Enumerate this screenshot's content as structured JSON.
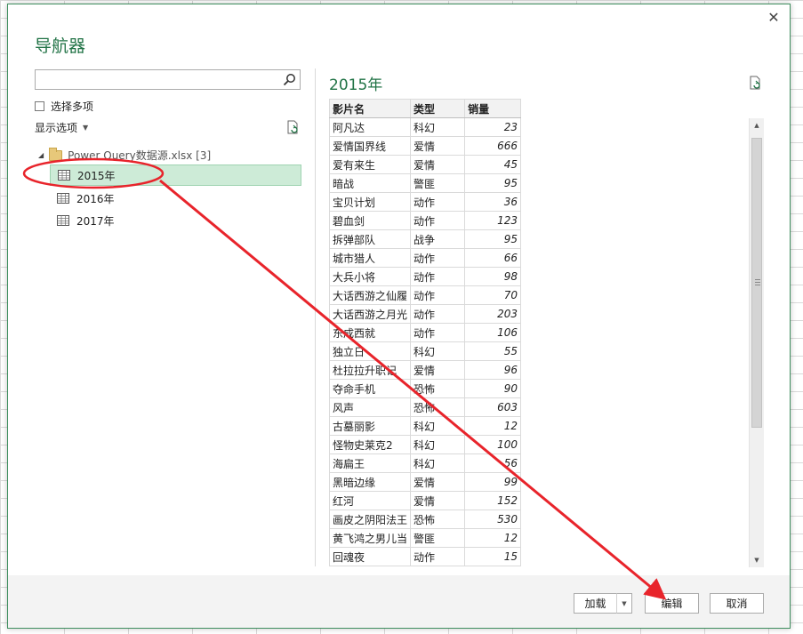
{
  "navigator": {
    "title": "导航器",
    "close_glyph": "✕",
    "search": {
      "value": "",
      "placeholder": ""
    },
    "select_multiple_label": "选择多项",
    "display_options_label": "显示选项",
    "tree": {
      "root_label": "Power Query数据源.xlsx [3]",
      "items": [
        {
          "label": "2015年",
          "selected": true
        },
        {
          "label": "2016年",
          "selected": false
        },
        {
          "label": "2017年",
          "selected": false
        }
      ]
    },
    "preview": {
      "title": "2015年",
      "columns": [
        "影片名",
        "类型",
        "销量"
      ],
      "rows": [
        [
          "阿凡达",
          "科幻",
          "23"
        ],
        [
          "爱情国界线",
          "爱情",
          "666"
        ],
        [
          "爱有来生",
          "爱情",
          "45"
        ],
        [
          "暗战",
          "警匪",
          "95"
        ],
        [
          "宝贝计划",
          "动作",
          "36"
        ],
        [
          "碧血剑",
          "动作",
          "123"
        ],
        [
          "拆弹部队",
          "战争",
          "95"
        ],
        [
          "城市猎人",
          "动作",
          "66"
        ],
        [
          "大兵小将",
          "动作",
          "98"
        ],
        [
          "大话西游之仙履",
          "动作",
          "70"
        ],
        [
          "大话西游之月光",
          "动作",
          "203"
        ],
        [
          "东成西就",
          "动作",
          "106"
        ],
        [
          "独立日",
          "科幻",
          "55"
        ],
        [
          "杜拉拉升职记",
          "爱情",
          "96"
        ],
        [
          "夺命手机",
          "恐怖",
          "90"
        ],
        [
          "风声",
          "恐怖",
          "603"
        ],
        [
          "古墓丽影",
          "科幻",
          "12"
        ],
        [
          "怪物史莱克2",
          "科幻",
          "100"
        ],
        [
          "海扁王",
          "科幻",
          "56"
        ],
        [
          "黑暗边缘",
          "爱情",
          "99"
        ],
        [
          "红河",
          "爱情",
          "152"
        ],
        [
          "画皮之阴阳法王",
          "恐怖",
          "530"
        ],
        [
          "黄飞鸿之男儿当",
          "警匪",
          "12"
        ],
        [
          "回魂夜",
          "动作",
          "15"
        ]
      ]
    },
    "buttons": {
      "load": "加载",
      "edit": "编辑",
      "cancel": "取消"
    },
    "colors": {
      "accent": "#217346",
      "selection": "#cdebd7",
      "annotation": "#e8242b"
    }
  }
}
